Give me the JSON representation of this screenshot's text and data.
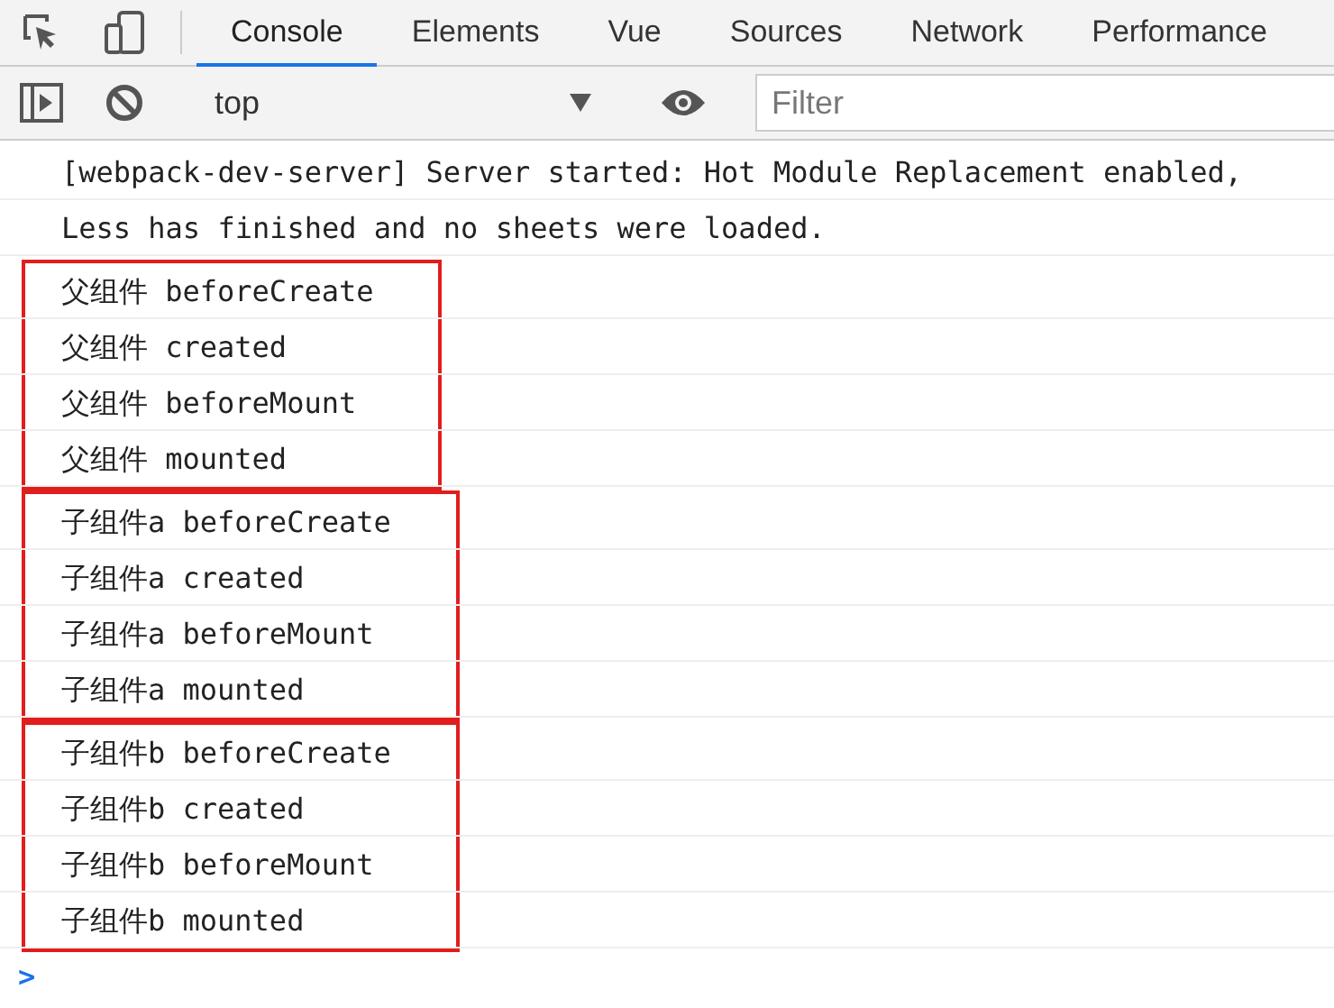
{
  "tabs": [
    {
      "label": "Console",
      "selected": true
    },
    {
      "label": "Elements",
      "selected": false
    },
    {
      "label": "Vue",
      "selected": false
    },
    {
      "label": "Sources",
      "selected": false
    },
    {
      "label": "Network",
      "selected": false
    },
    {
      "label": "Performance",
      "selected": false
    }
  ],
  "toolbar": {
    "context": "top",
    "filter": {
      "placeholder": "Filter"
    }
  },
  "groups": [
    {
      "highlighted": false,
      "messages": [
        "[webpack-dev-server] Server started: Hot Module Replacement enabled,",
        "Less has finished and no sheets were loaded."
      ]
    },
    {
      "highlighted": true,
      "messages": [
        "父组件 beforeCreate",
        "父组件 created",
        "父组件 beforeMount",
        "父组件 mounted"
      ]
    },
    {
      "highlighted": true,
      "messages": [
        "子组件a beforeCreate",
        "子组件a created",
        "子组件a beforeMount",
        "子组件a mounted"
      ]
    },
    {
      "highlighted": true,
      "messages": [
        "子组件b beforeCreate",
        "子组件b created",
        "子组件b beforeMount",
        "子组件b mounted"
      ]
    }
  ],
  "prompt": ">"
}
